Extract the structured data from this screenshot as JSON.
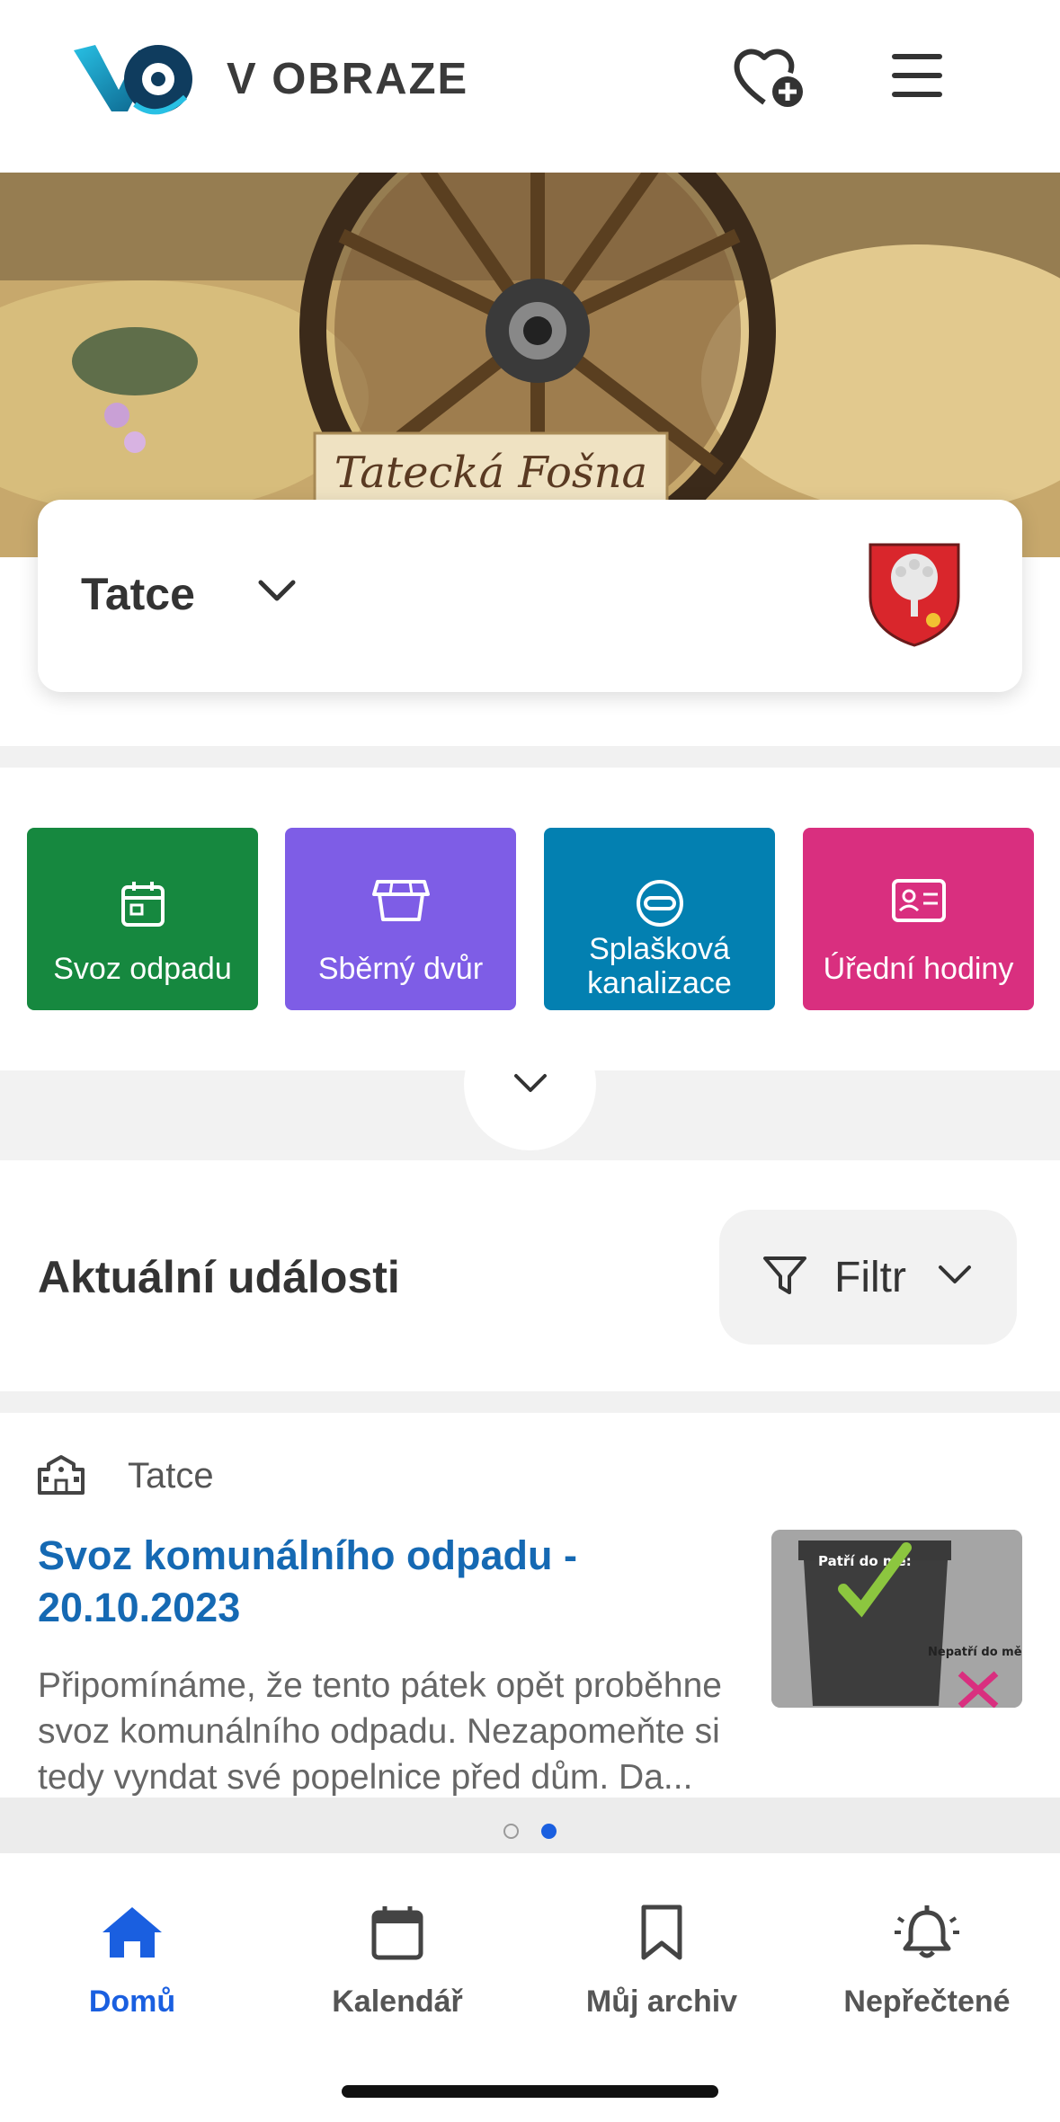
{
  "header": {
    "brand": "V OBRAZE",
    "logo_icon": "vo-logo",
    "favorite_icon": "heart-plus-icon",
    "menu_icon": "hamburger-menu-icon"
  },
  "hero": {
    "sign_text": "Tatecká Fošna"
  },
  "town": {
    "name": "Tatce",
    "chevron_icon": "chevron-down-icon",
    "coat_of_arms": "coat-of-arms-icon"
  },
  "tiles": [
    {
      "label": "Svoz odpadu",
      "icon": "calendar-icon",
      "color": "#16883f"
    },
    {
      "label": "Sběrný dvůr",
      "icon": "container-icon",
      "color": "#7e5de6"
    },
    {
      "label_line1": "Splašková",
      "label_line2": "kanalizace",
      "icon": "sewer-icon",
      "color": "#0380b1"
    },
    {
      "label": "Úřední hodiny",
      "icon": "id-card-icon",
      "color": "#d92f7f"
    }
  ],
  "events": {
    "title": "Aktuální události",
    "filter_label": "Filtr",
    "card": {
      "location": "Tatce",
      "headline": "Svoz komunálního odpadu - 20.10.2023",
      "body": "Připomínáme, že tento pátek opět proběhne svoz komunálního odpadu. Nezapomeňte si tedy vyndat své popelnice před dům. Da...",
      "thumb_title": "Patří do mě:",
      "thumb_side": "Nepatří do mě:"
    },
    "pager": {
      "count": 2,
      "active": 2
    }
  },
  "nav": {
    "items": [
      {
        "label": "Domů",
        "icon": "home-icon",
        "active": true
      },
      {
        "label": "Kalendář",
        "icon": "calendar-icon",
        "active": false
      },
      {
        "label": "Můj archiv",
        "icon": "bookmark-icon",
        "active": false
      },
      {
        "label": "Nepřečtené",
        "icon": "bell-icon",
        "active": false
      }
    ]
  },
  "colors": {
    "accent": "#1a5fe0",
    "headline": "#1569b3"
  }
}
